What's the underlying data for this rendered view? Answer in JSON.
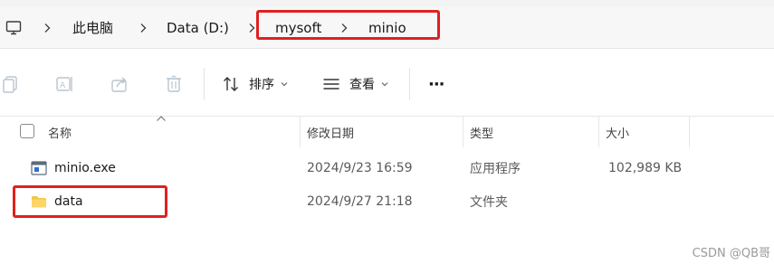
{
  "address_bar": {
    "pc_icon": "computer-icon",
    "separator_icon": "chevron-right-icon",
    "crumbs": [
      "此电脑",
      "Data (D:)",
      "mysoft",
      "minio"
    ]
  },
  "toolbar": {
    "icons": [
      "copy-icon",
      "rename-icon",
      "share-icon",
      "delete-icon"
    ],
    "sort_label": "排序",
    "view_label": "查看",
    "more_label": "···"
  },
  "columns": {
    "name": "名称",
    "modified": "修改日期",
    "type": "类型",
    "size": "大小"
  },
  "files": [
    {
      "name": "minio.exe",
      "icon": "exe-file-icon",
      "modified": "2024/9/23 16:59",
      "type": "应用程序",
      "size": "102,989 KB"
    },
    {
      "name": "data",
      "icon": "folder-icon",
      "modified": "2024/9/27 21:18",
      "type": "文件夹",
      "size": ""
    }
  ],
  "colors": {
    "highlight_box": "#e02020",
    "address_bg": "#f7f7f7",
    "folder": "#f6c445"
  },
  "watermark": "CSDN @QB哥"
}
